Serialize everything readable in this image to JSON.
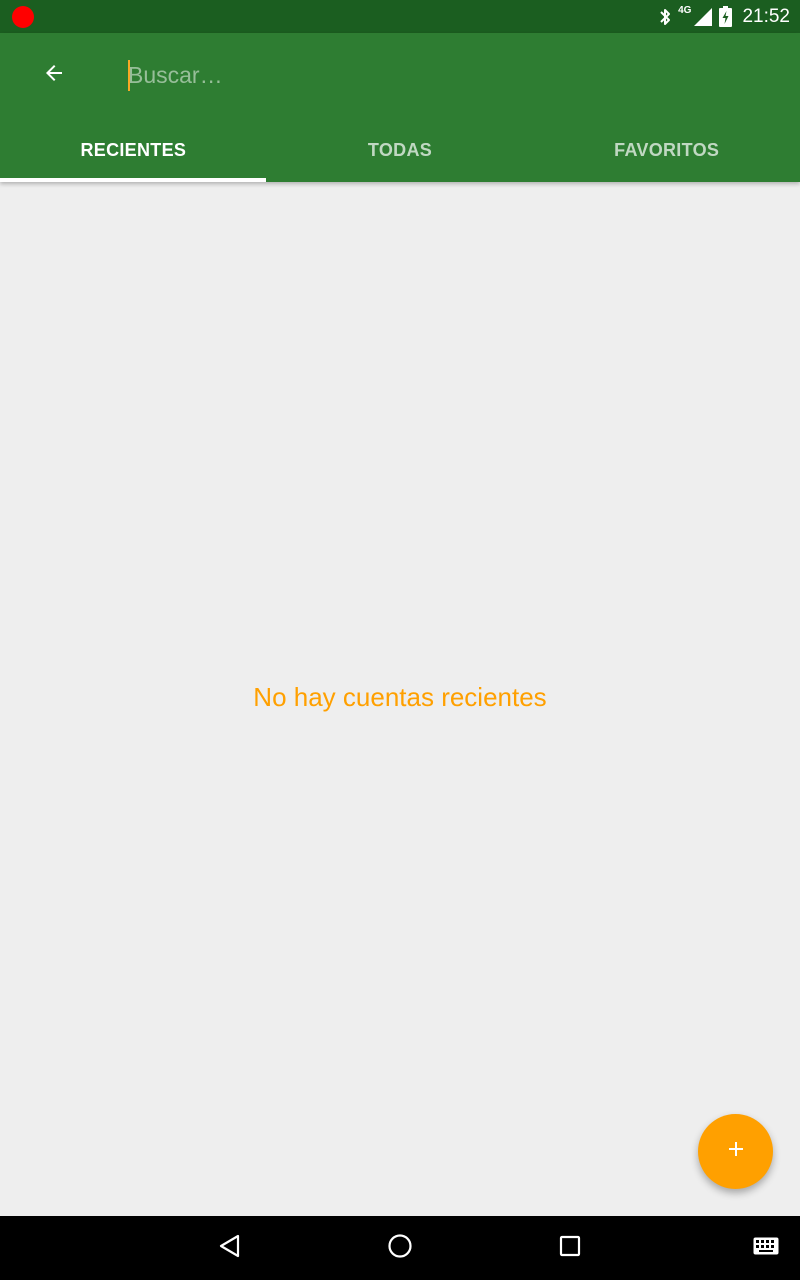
{
  "status_bar": {
    "network": "4G",
    "time": "21:52",
    "icons": [
      "record-indicator-icon",
      "bluetooth-icon",
      "cell-signal-icon",
      "battery-charging-icon"
    ]
  },
  "app_bar": {
    "back_icon": "arrow-back-icon",
    "search": {
      "value": "",
      "placeholder": "Buscar…"
    },
    "tabs": [
      {
        "label": "RECIENTES",
        "active": true
      },
      {
        "label": "TODAS",
        "active": false
      },
      {
        "label": "FAVORITOS",
        "active": false
      }
    ]
  },
  "content": {
    "empty_message": "No hay cuentas recientes"
  },
  "fab": {
    "icon": "add-icon"
  },
  "nav_bar": {
    "icons": [
      "nav-back-icon",
      "home-icon",
      "recents-icon",
      "keyboard-icon"
    ]
  },
  "colors": {
    "status_bar": "#1b5e20",
    "primary": "#2e7d32",
    "accent": "#ffa000",
    "background": "#eeeeee"
  }
}
